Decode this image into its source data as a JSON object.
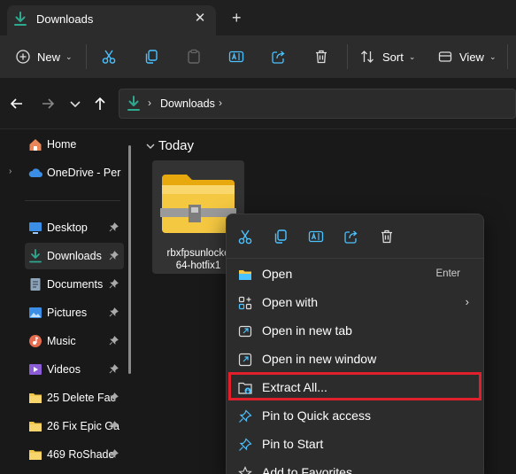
{
  "tab": {
    "title": "Downloads",
    "close": "✕",
    "new_tab": "+"
  },
  "toolbar": {
    "new_label": "New",
    "sort_label": "Sort",
    "view_label": "View",
    "caret": "⌄"
  },
  "address": {
    "chevron": "›",
    "location": "Downloads"
  },
  "sidebar": {
    "home": "Home",
    "onedrive": "OneDrive - Perso",
    "expand": "›",
    "items": [
      {
        "label": "Desktop",
        "icon": "desktop-icon",
        "color": "#3a8ee6"
      },
      {
        "label": "Downloads",
        "icon": "download-icon",
        "color": "#2ea88f"
      },
      {
        "label": "Documents",
        "icon": "document-icon",
        "color": "#8ea4b8"
      },
      {
        "label": "Pictures",
        "icon": "pictures-icon",
        "color": "#3a8ee6"
      },
      {
        "label": "Music",
        "icon": "music-icon",
        "color": "#e46b4e"
      },
      {
        "label": "Videos",
        "icon": "videos-icon",
        "color": "#8b5cd6"
      },
      {
        "label": "25 Delete Fac",
        "icon": "folder-icon",
        "color": "#f2c84b"
      },
      {
        "label": "26 Fix Epic Ga",
        "icon": "folder-icon",
        "color": "#f2c84b"
      },
      {
        "label": "469 RoShade",
        "icon": "folder-icon",
        "color": "#f2c84b"
      }
    ]
  },
  "content": {
    "group": "Today",
    "file": {
      "line1": "rbxfpsunlocke",
      "line2": "64-hotfix1"
    }
  },
  "menu": {
    "items": [
      {
        "label": "Open",
        "accelerator": "Enter"
      },
      {
        "label": "Open with",
        "submenu": "›"
      },
      {
        "label": "Open in new tab"
      },
      {
        "label": "Open in new window"
      },
      {
        "label": "Extract All..."
      },
      {
        "label": "Pin to Quick access"
      },
      {
        "label": "Pin to Start"
      },
      {
        "label": "Add to Favorites"
      }
    ]
  },
  "colors": {
    "accent": "#4cc2ff",
    "highlight": "#e0202a",
    "folder": "#f2c84b"
  }
}
